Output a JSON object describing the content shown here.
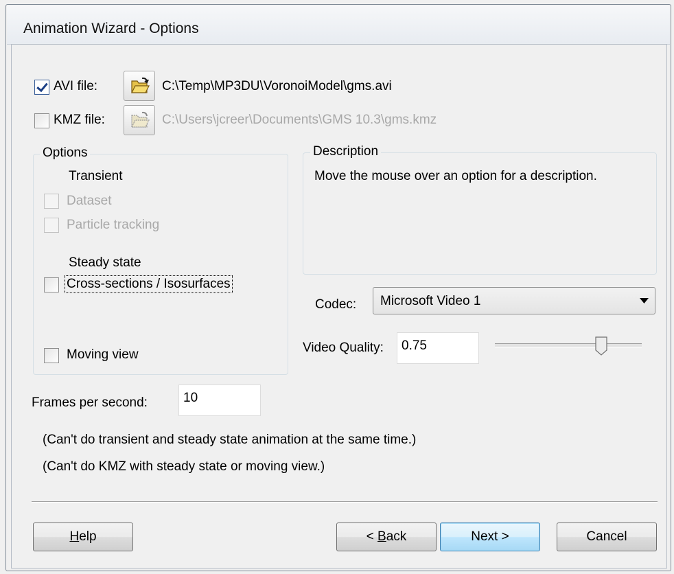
{
  "window": {
    "title": "Animation Wizard - Options"
  },
  "files": {
    "avi": {
      "label": "AVI file:",
      "checked": true,
      "path": "C:\\Temp\\MP3DU\\VoronoiModel\\gms.avi"
    },
    "kmz": {
      "label": "KMZ file:",
      "checked": false,
      "path": "C:\\Users\\jcreer\\Documents\\GMS 10.3\\gms.kmz"
    }
  },
  "options": {
    "title": "Options",
    "transient_header": "Transient",
    "dataset_label": "Dataset",
    "particle_label": "Particle tracking",
    "steady_header": "Steady state",
    "cross_sections_label": "Cross-sections / Isosurfaces",
    "moving_view_label": "Moving view"
  },
  "description": {
    "title": "Description",
    "text": "Move the mouse over an option for a description."
  },
  "codec": {
    "label": "Codec:",
    "value": "Microsoft Video 1"
  },
  "video_quality": {
    "label": "Video Quality:",
    "value": "0.75",
    "slider_fraction": 0.75
  },
  "frames": {
    "label": "Frames per second:",
    "value": "10"
  },
  "notes": {
    "line1": "(Can't do transient and steady state animation at the same time.)",
    "line2": "(Can't do KMZ with steady state or moving view.)"
  },
  "buttons": {
    "help_rest": "elp",
    "help_mnemonic": "H",
    "back_prefix": "< ",
    "back_mnemonic": "B",
    "back_rest": "ack",
    "next": "Next >",
    "cancel": "Cancel"
  },
  "icons": {
    "avi_browse": "open-folder-icon",
    "kmz_browse": "open-folder-icon-disabled",
    "dropdown": "triangle-down-icon"
  }
}
